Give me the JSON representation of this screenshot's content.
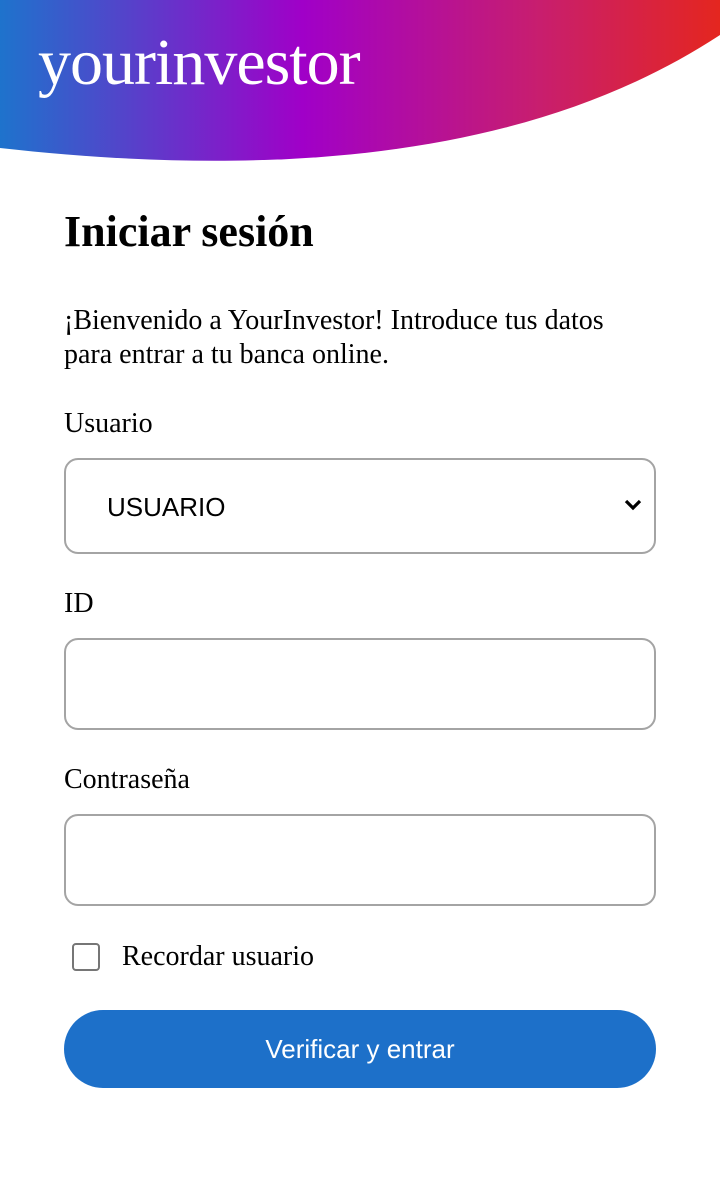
{
  "header": {
    "logo": "yourinvestor",
    "gradient": [
      "#1e73cc",
      "#a000c8",
      "#e4261f"
    ]
  },
  "login": {
    "title": "Iniciar sesión",
    "intro": "¡Bienvenido a YourInvestor! Introduce tus datos para entrar a tu banca online.",
    "user_label": "Usuario",
    "user_select_value": "USUARIO",
    "id_label": "ID",
    "id_value": "",
    "password_label": "Contraseña",
    "password_value": "",
    "remember_label": "Recordar usuario",
    "remember_checked": false,
    "submit_label": "Verificar y entrar",
    "accent": "#1d70c9"
  }
}
